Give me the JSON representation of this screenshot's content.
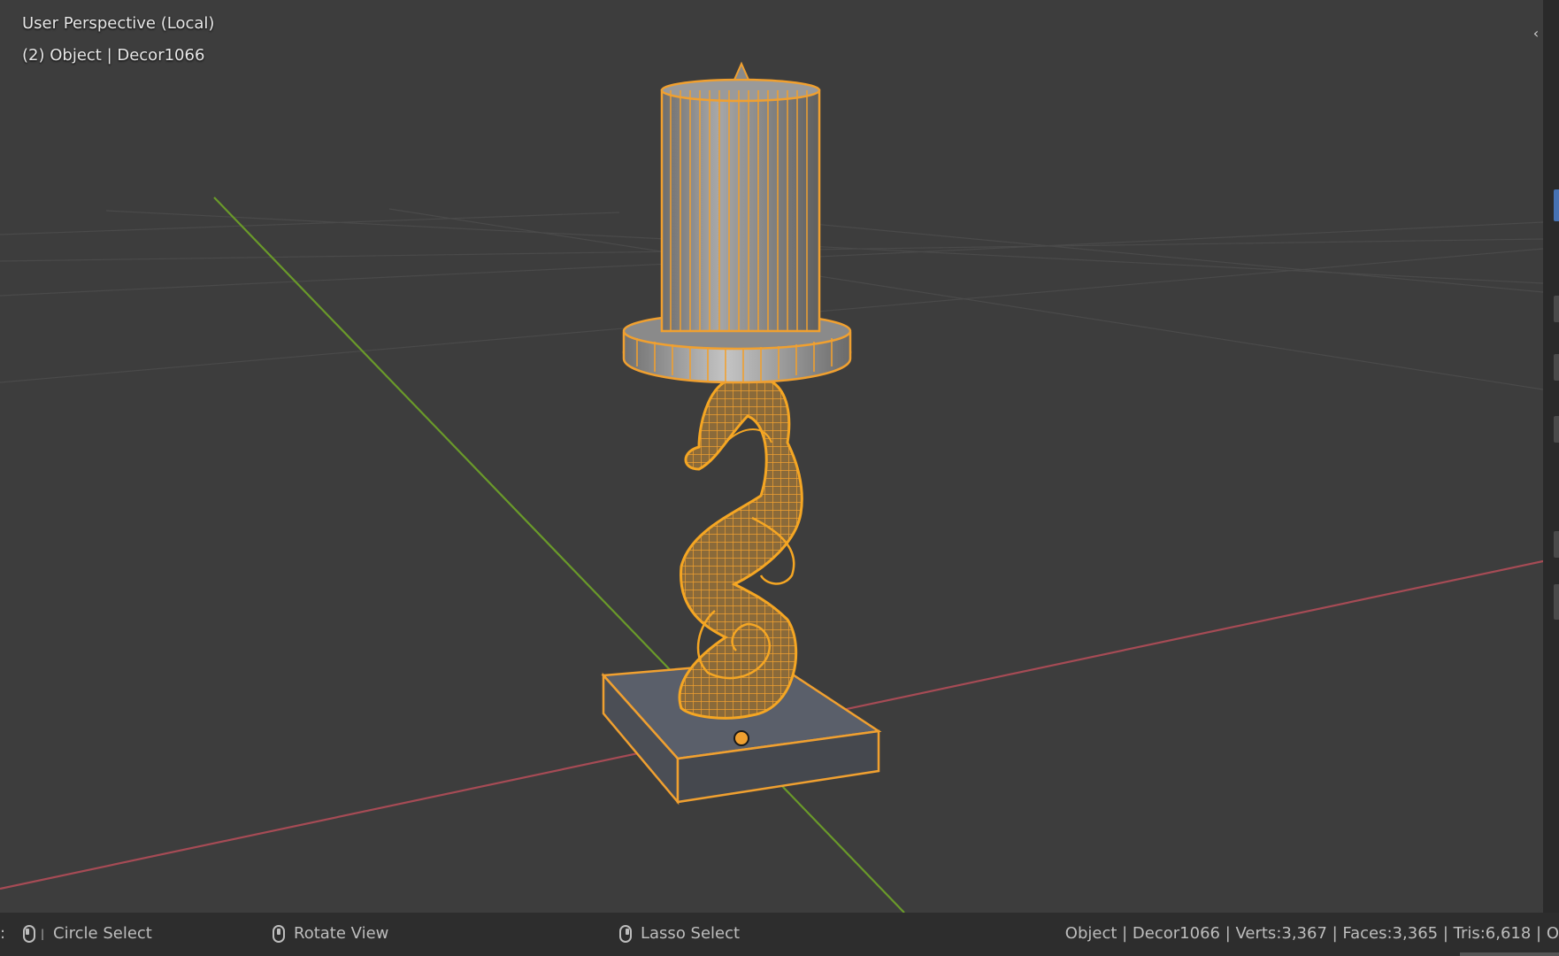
{
  "viewport": {
    "view_label": "User Perspective (Local)",
    "object_label": "(2) Object | Decor1066",
    "colors": {
      "background": "#3d3d3d",
      "grid": "#4a4a4a",
      "x_axis": "#a64b55",
      "y_axis": "#6a9a2a",
      "selection": "#f0a030",
      "solid_gray": "#8e8e8e",
      "base_top": "#5a5f6a"
    },
    "collapse_icon": "chevron-left-icon"
  },
  "statusbar": {
    "circle_select": "Circle Select",
    "rotate_view": "Rotate View",
    "lasso_select": "Lasso Select",
    "stats": "Object | Decor1066 | Verts:3,367 | Faces:3,365 | Tris:6,618 | O",
    "icons": [
      "mouse-left-icon",
      "mouse-middle-icon",
      "mouse-right-icon"
    ]
  }
}
